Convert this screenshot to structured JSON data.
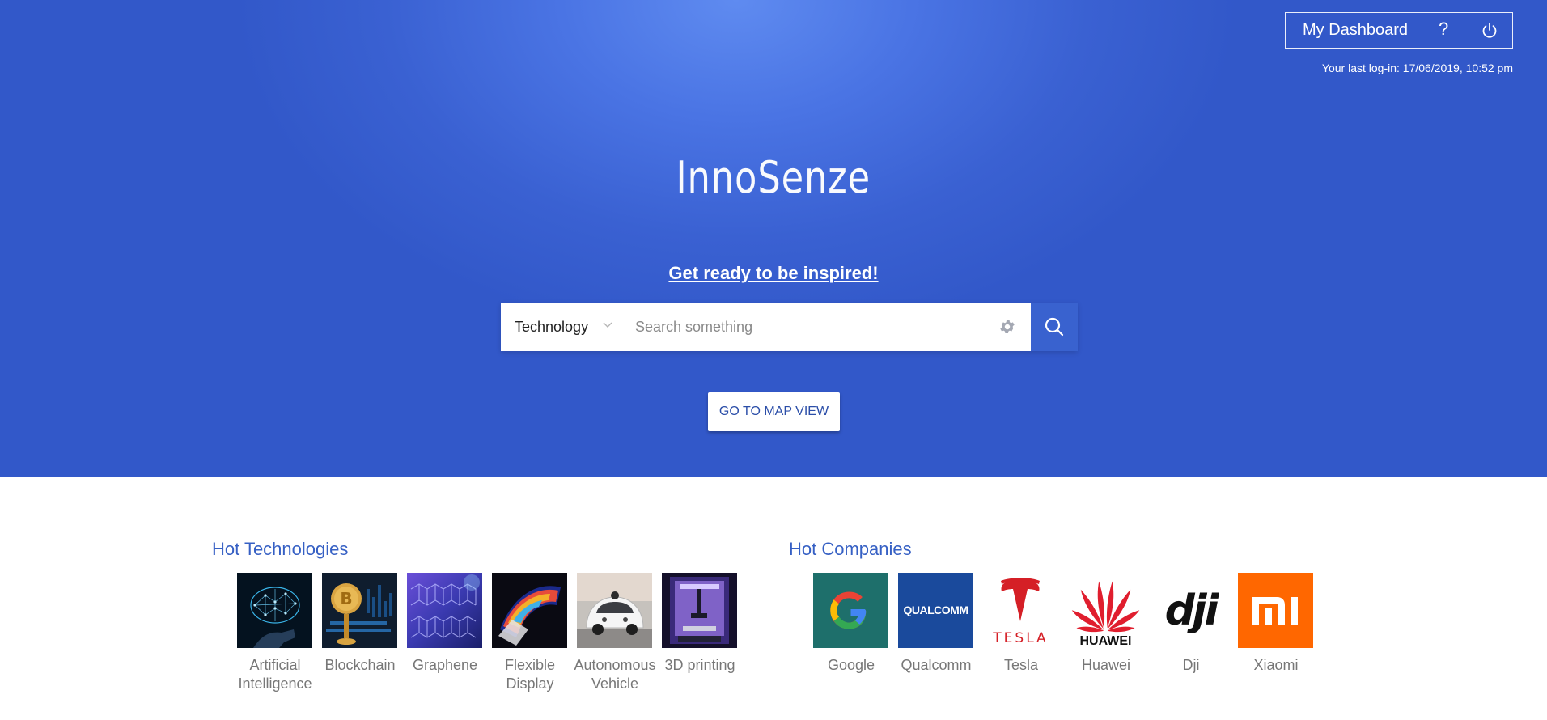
{
  "header": {
    "dashboard_label": "My Dashboard",
    "help_label": "?",
    "power_icon": "power-icon",
    "last_login": "Your last log-in: 17/06/2019, 10:52 pm"
  },
  "hero": {
    "logo": "InnoSenze",
    "tagline": "Get ready to be inspired!",
    "background_color": "#3a61d2"
  },
  "search": {
    "category": "Technology",
    "placeholder": "Search something",
    "value": "",
    "settings_icon": "gear-icon",
    "submit_icon": "search-icon"
  },
  "map_button": "GO TO MAP VIEW",
  "hot_technologies": {
    "title": "Hot Technologies",
    "items": [
      {
        "label": "Artificial Intelligence"
      },
      {
        "label": "Blockchain"
      },
      {
        "label": "Graphene"
      },
      {
        "label": "Flexible Display"
      },
      {
        "label": "Autonomous Vehicle"
      },
      {
        "label": "3D printing"
      }
    ]
  },
  "hot_companies": {
    "title": "Hot Companies",
    "items": [
      {
        "label": "Google",
        "logo_text": "G",
        "bg": "#1e6f6b"
      },
      {
        "label": "Qualcomm",
        "logo_text": "QUALCOMM",
        "bg": "#1a4a9c"
      },
      {
        "label": "Tesla",
        "logo_text": "TESLA",
        "bg": "#ffffff"
      },
      {
        "label": "Huawei",
        "logo_text": "HUAWEI",
        "bg": "#ffffff"
      },
      {
        "label": "Dji",
        "logo_text": "dji",
        "bg": "#ffffff"
      },
      {
        "label": "Xiaomi",
        "logo_text": "mi",
        "bg": "#ff6700"
      }
    ]
  }
}
